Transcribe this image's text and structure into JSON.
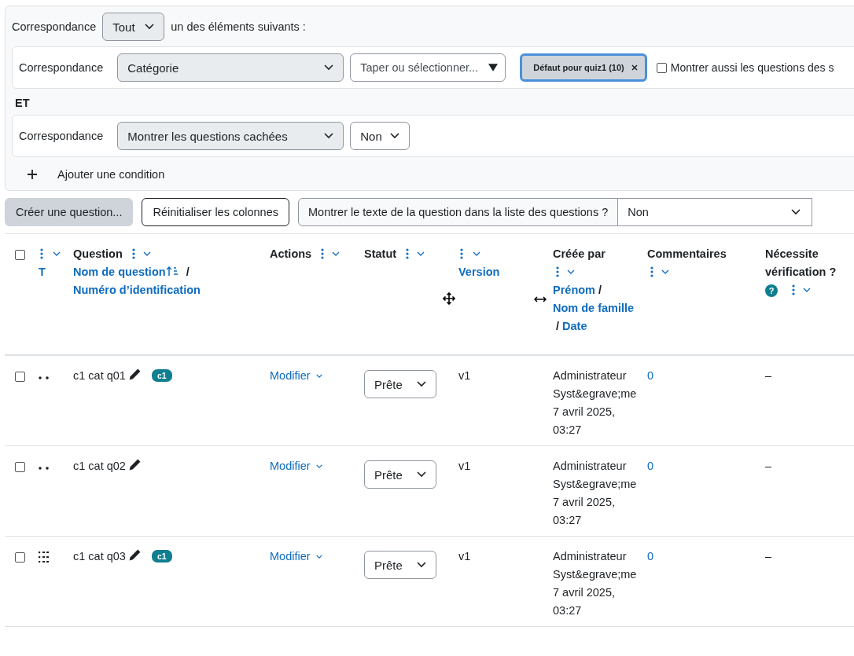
{
  "filter": {
    "match_label": "Correspondance",
    "match_value": "Tout",
    "match_suffix": "un des éléments suivants :",
    "conditions": [
      {
        "kind": "category",
        "label": "Correspondance",
        "field": "Catégorie",
        "placeholder": "Taper ou sélectionner...",
        "chips": [
          "Défaut pour quiz1 (10)"
        ],
        "option": {
          "label": "Montrer aussi les questions des s",
          "checked": false
        }
      },
      {
        "kind": "select",
        "label": "Correspondance",
        "field": "Montrer les questions cachées",
        "value": "Non"
      }
    ],
    "joiner": "ET",
    "add_label": "Ajouter une condition"
  },
  "toolbar": {
    "create": "Créer une question...",
    "reset": "Réinitialiser les colonnes",
    "show_text_label": "Montrer le texte de la question dans la liste des questions ?",
    "show_text_value": "Non"
  },
  "table": {
    "select_all_checked": false,
    "columns": [
      {
        "kind": "type",
        "links": [
          {
            "label": "T",
            "sorted": false
          }
        ]
      },
      {
        "kind": "question",
        "title": "Question",
        "separator": "/",
        "links": [
          {
            "label": "Nom de question",
            "sorted": true
          },
          {
            "label": "Numéro d’identification",
            "sorted": false
          }
        ]
      },
      {
        "kind": "plain",
        "title": "Actions"
      },
      {
        "kind": "plain",
        "title": "Statut",
        "move_handle": true
      },
      {
        "kind": "type",
        "links": [
          {
            "label": "Version",
            "sorted": false
          }
        ],
        "resize_handle": true
      },
      {
        "kind": "question",
        "title": "Créée par",
        "separator": "/",
        "links": [
          {
            "label": "Prénom",
            "sorted": false
          },
          {
            "label": "Nom de famille",
            "sorted": false
          },
          {
            "label": "Date",
            "sorted": false
          }
        ]
      },
      {
        "kind": "plain",
        "title": "Commentaires"
      },
      {
        "kind": "help",
        "title": "Nécessite vérification ?",
        "help_icon": "?"
      }
    ],
    "rows": [
      {
        "checked": false,
        "kind": "dots",
        "name": "c1 cat q01",
        "tags": [
          "c1"
        ],
        "action": "Modifier",
        "status": "Prête",
        "version": "v1",
        "creator": "Administrateur Syst&egrave;me",
        "created": "7 avril 2025, 03:27",
        "comments": "0",
        "review": "–"
      },
      {
        "checked": false,
        "kind": "dots",
        "name": "c1 cat q02",
        "action": "Modifier",
        "status": "Prête",
        "version": "v1",
        "creator": "Administrateur Syst&egrave;me",
        "created": "7 avril 2025, 03:27",
        "comments": "0",
        "review": "–"
      },
      {
        "checked": false,
        "kind": "grid",
        "name": "c1 cat q03",
        "tags": [
          "c1"
        ],
        "action": "Modifier",
        "status": "Prête",
        "version": "v1",
        "creator": "Administrateur Syst&egrave;me",
        "created": "7 avril 2025, 03:27",
        "comments": "0",
        "review": "–"
      }
    ]
  }
}
